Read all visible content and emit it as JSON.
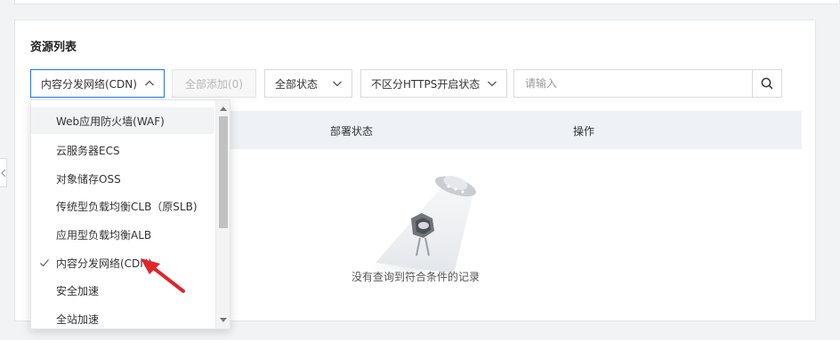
{
  "section": {
    "title": "资源列表"
  },
  "toolbar": {
    "product_select_value": "内容分发网络(CDN)",
    "add_all_label": "全部添加(0)",
    "status_select_value": "全部状态",
    "https_select_value": "不区分HTTPS开启状态",
    "search_placeholder": "请输入"
  },
  "table": {
    "columns": [
      "部署状态",
      "操作"
    ],
    "empty_text": "没有查询到符合条件的记录"
  },
  "dropdown": {
    "items": [
      {
        "label": "Web应用防火墙(WAF)",
        "selected": false,
        "hover": true
      },
      {
        "label": "云服务器ECS",
        "selected": false,
        "hover": false
      },
      {
        "label": "对象储存OSS",
        "selected": false,
        "hover": false
      },
      {
        "label": "传统型负载均衡CLB（原SLB)",
        "selected": false,
        "hover": false
      },
      {
        "label": "应用型负载均衡ALB",
        "selected": false,
        "hover": false
      },
      {
        "label": "内容分发网络(CDN)",
        "selected": true,
        "hover": false
      },
      {
        "label": "安全加速",
        "selected": false,
        "hover": false
      },
      {
        "label": "全站加速",
        "selected": false,
        "hover": false
      }
    ]
  },
  "icons": {
    "search": "search-icon",
    "chevron": "chevron-icon",
    "check": "check-icon",
    "empty": "empty-state-icon",
    "annotation": "red-arrow-annotation"
  },
  "colors": {
    "accent": "#1677ff",
    "annotation": "#e0262a",
    "header_bg": "#eef1f5"
  }
}
